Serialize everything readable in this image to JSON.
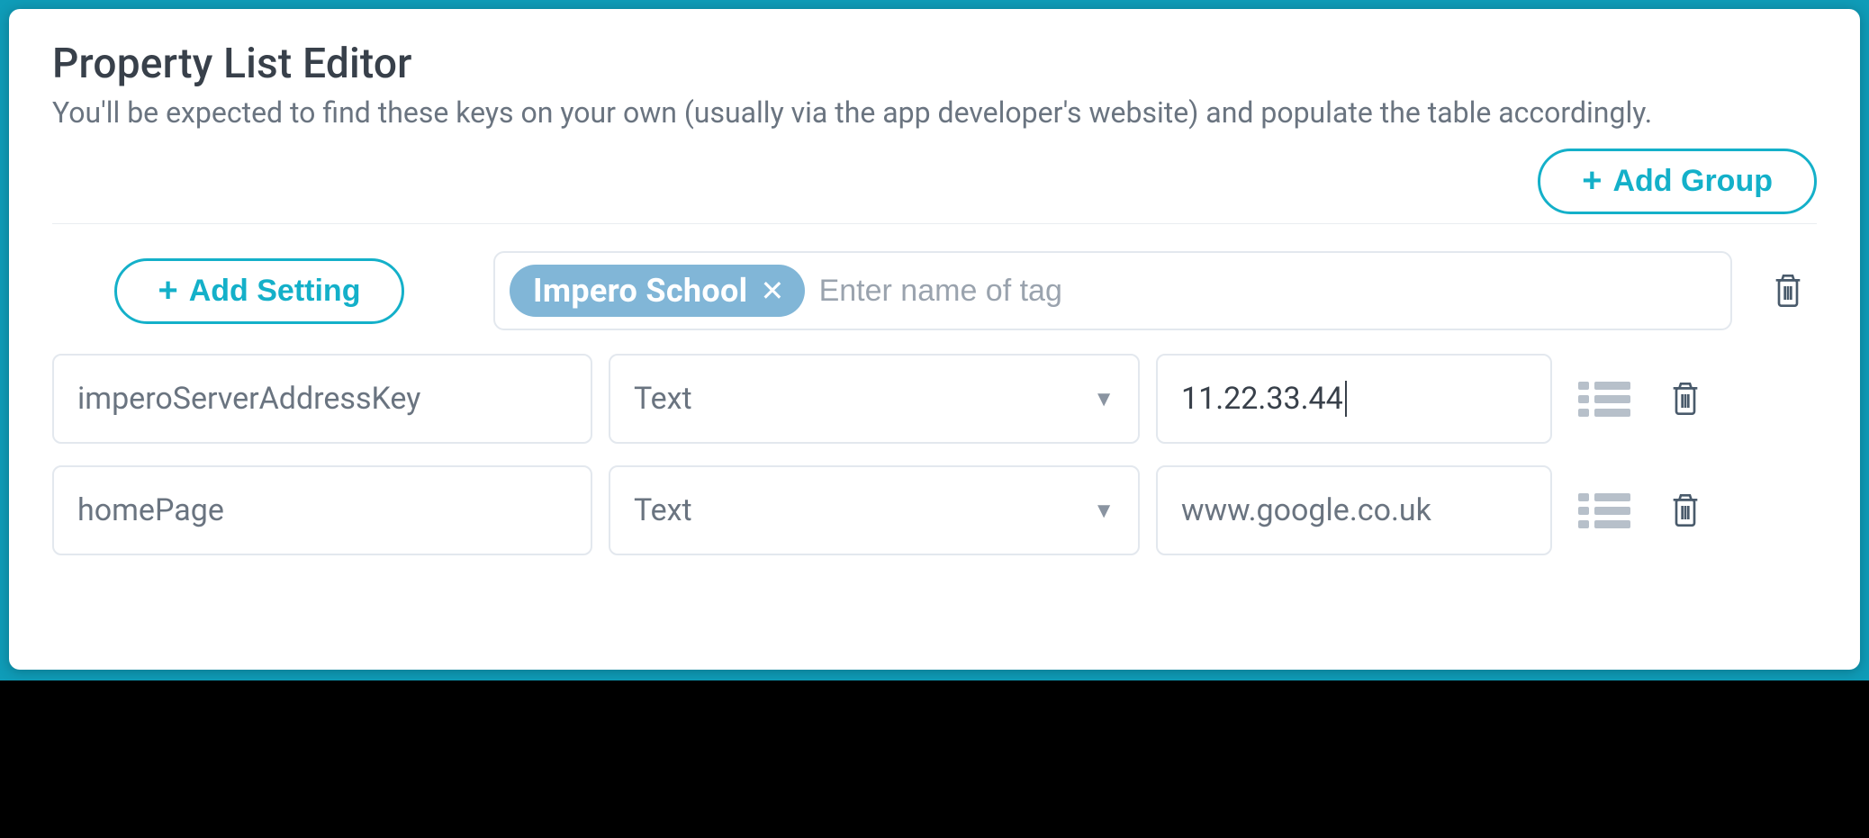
{
  "header": {
    "title": "Property List Editor",
    "subtitle": "You'll be expected to find these keys on your own (usually via the app developer's website) and populate the table accordingly."
  },
  "buttons": {
    "add_group": "Add Group",
    "add_setting": "Add Setting"
  },
  "tag_row": {
    "chip_label": "Impero School",
    "placeholder": "Enter name of tag"
  },
  "settings": [
    {
      "key": "imperoServerAddressKey",
      "type": "Text",
      "value": "11.22.33.44",
      "active": true
    },
    {
      "key": "homePage",
      "type": "Text",
      "value": "www.google.co.uk",
      "active": false
    }
  ]
}
